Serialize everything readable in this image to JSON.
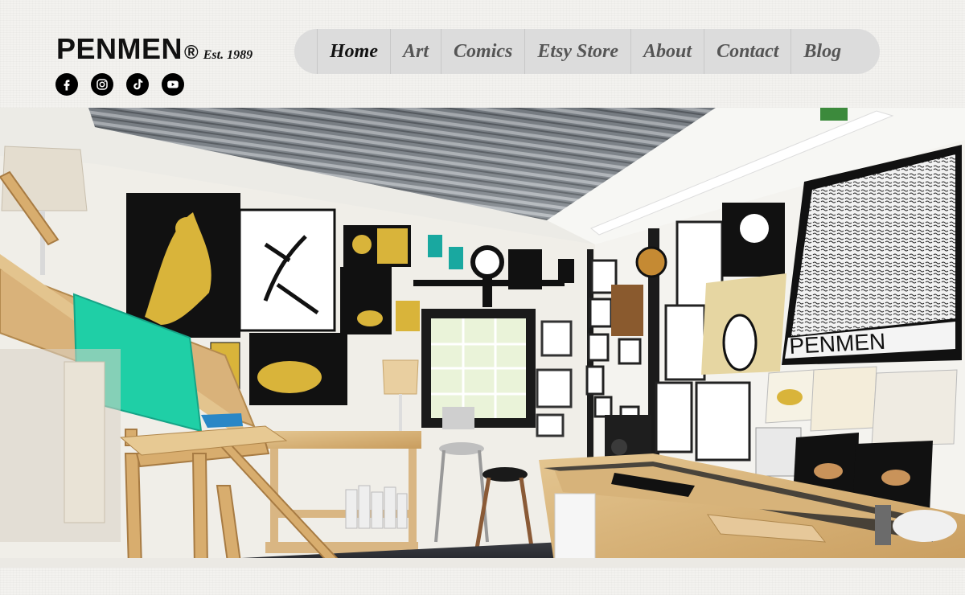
{
  "brand": {
    "name": "PENMEN",
    "registered": "®",
    "established": "Est. 1989"
  },
  "social": [
    {
      "icon": "facebook-icon"
    },
    {
      "icon": "instagram-icon"
    },
    {
      "icon": "tiktok-icon"
    },
    {
      "icon": "youtube-icon"
    }
  ],
  "nav": {
    "items": [
      {
        "label": "Home",
        "active": true
      },
      {
        "label": "Art"
      },
      {
        "label": "Comics"
      },
      {
        "label": "Etsy Store"
      },
      {
        "label": "About"
      },
      {
        "label": "Contact"
      },
      {
        "label": "Blog"
      }
    ]
  },
  "hero": {
    "penmen_sign": "PENMEN",
    "colors": {
      "ceiling": "#6f747a",
      "wall": "#f1efe9",
      "wood": "#d7b37a",
      "teal": "#19c7a1",
      "gold": "#d9b43a",
      "black": "#111111"
    }
  }
}
